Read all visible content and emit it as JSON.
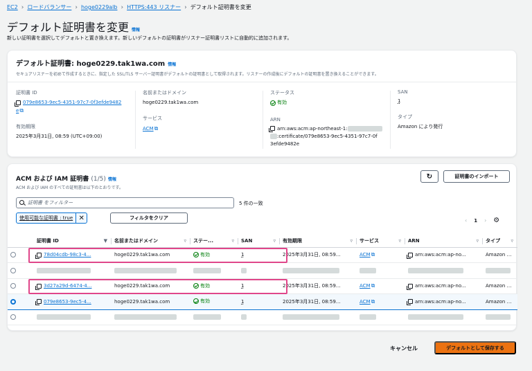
{
  "breadcrumb": [
    {
      "label": "EC2"
    },
    {
      "label": "ロードバランサー"
    },
    {
      "label": "hoge0229alb"
    },
    {
      "label": "HTTPS:443 リスナー"
    },
    {
      "label": "デフォルト証明書を変更"
    }
  ],
  "page": {
    "title": "デフォルト証明書を変更",
    "info": "情報",
    "description": "新しい証明書を選択してデフォルトと置き換えます。新しいデフォルトの証明書がリスナー証明書リストに自動的に追加されます。"
  },
  "default_cert": {
    "title": "デフォルト証明書: hoge0229.tak1wa.com",
    "info": "情報",
    "subtitle": "セキュアリスナーを初めて作成するときに、指定した SSL/TLS サーバー証明書がデフォルトの証明書として取得されます。リスナーの作成後にデフォルトの証明書を置き換えることができます。",
    "cert_id_label": "証明書 ID",
    "cert_id_value": "079e8653-9ec5-4351-97c7-0f3efde9482e",
    "cert_id_line1": "079e8653-9ec5-4351-97c7-0f3efde9482",
    "cert_id_line2": "e",
    "expiry_label": "有効期限",
    "expiry_value": "2025年3月31日, 08:59 (UTC+09:00)",
    "domain_label": "名前またはドメイン",
    "domain_value": "hoge0229.tak1wa.com",
    "service_label": "サービス",
    "service_value": "ACM",
    "status_label": "ステータス",
    "status_value": "有効",
    "arn_label": "ARN",
    "arn_line1": "arn:aws:acm:ap-northeast-1:",
    "arn_line2": ":certificate/079e8653-9ec5-4351-97c7-0f",
    "arn_line3": "3efde9482e",
    "san_label": "SAN",
    "san_value": "1",
    "type_label": "タイプ",
    "type_value": "Amazon により発行"
  },
  "cert_list": {
    "title": "ACM および IAM 証明書",
    "count": "(1/5)",
    "info": "情報",
    "subtitle": "ACM および IAM のすべての証明書は以下のとおりです。",
    "refresh_icon": "refresh-icon",
    "import_label": "証明書のインポート",
    "search_placeholder": "証明書 をフィルター",
    "match_count": "5 件の一致",
    "filter_token": "使用可能な証明書 : true",
    "clear_filter_label": "フィルタをクリア",
    "page_current": "1",
    "columns": [
      "証明書 ID",
      "名前またはドメイン",
      "ステー...",
      "SAN",
      "有効期限",
      "サービス",
      "ARN",
      "タイプ"
    ],
    "rows": [
      {
        "id": "78d04cdb-98c3-4...",
        "domain": "hoge0229.tak1wa.com",
        "status": "有効",
        "san": "1",
        "expiry": "2025年3月31日, 08:59...",
        "service": "ACM",
        "arn": "arn:aws:acm:ap-no...",
        "type": "Amazon に...",
        "selected": false,
        "blurred": false
      },
      {
        "id": "",
        "domain": "",
        "status": "",
        "san": "",
        "expiry": "",
        "service": "",
        "arn": "",
        "type": "",
        "selected": false,
        "blurred": true
      },
      {
        "id": "3d27a29d-6474-4...",
        "domain": "hoge0229.tak1wa.com",
        "status": "有効",
        "san": "1",
        "expiry": "2025年3月31日, 08:59...",
        "service": "ACM",
        "arn": "arn:aws:acm:ap-no...",
        "type": "Amazon に...",
        "selected": false,
        "blurred": false
      },
      {
        "id": "079e8653-9ec5-4...",
        "domain": "hoge0229.tak1wa.com",
        "status": "有効",
        "san": "1",
        "expiry": "2025年3月31日, 08:59...",
        "service": "ACM",
        "arn": "arn:aws:acm:ap-no...",
        "type": "Amazon に...",
        "selected": true,
        "blurred": false
      },
      {
        "id": "",
        "domain": "",
        "status": "",
        "san": "",
        "expiry": "",
        "service": "",
        "arn": "",
        "type": "",
        "selected": false,
        "blurred": true
      }
    ]
  },
  "footer": {
    "cancel_label": "キャンセル",
    "save_label": "デフォルトとして保存する"
  },
  "colors": {
    "link": "#0972d3",
    "primary_button": "#ec7211",
    "success": "#037f0c",
    "highlight": "#e0468a"
  }
}
